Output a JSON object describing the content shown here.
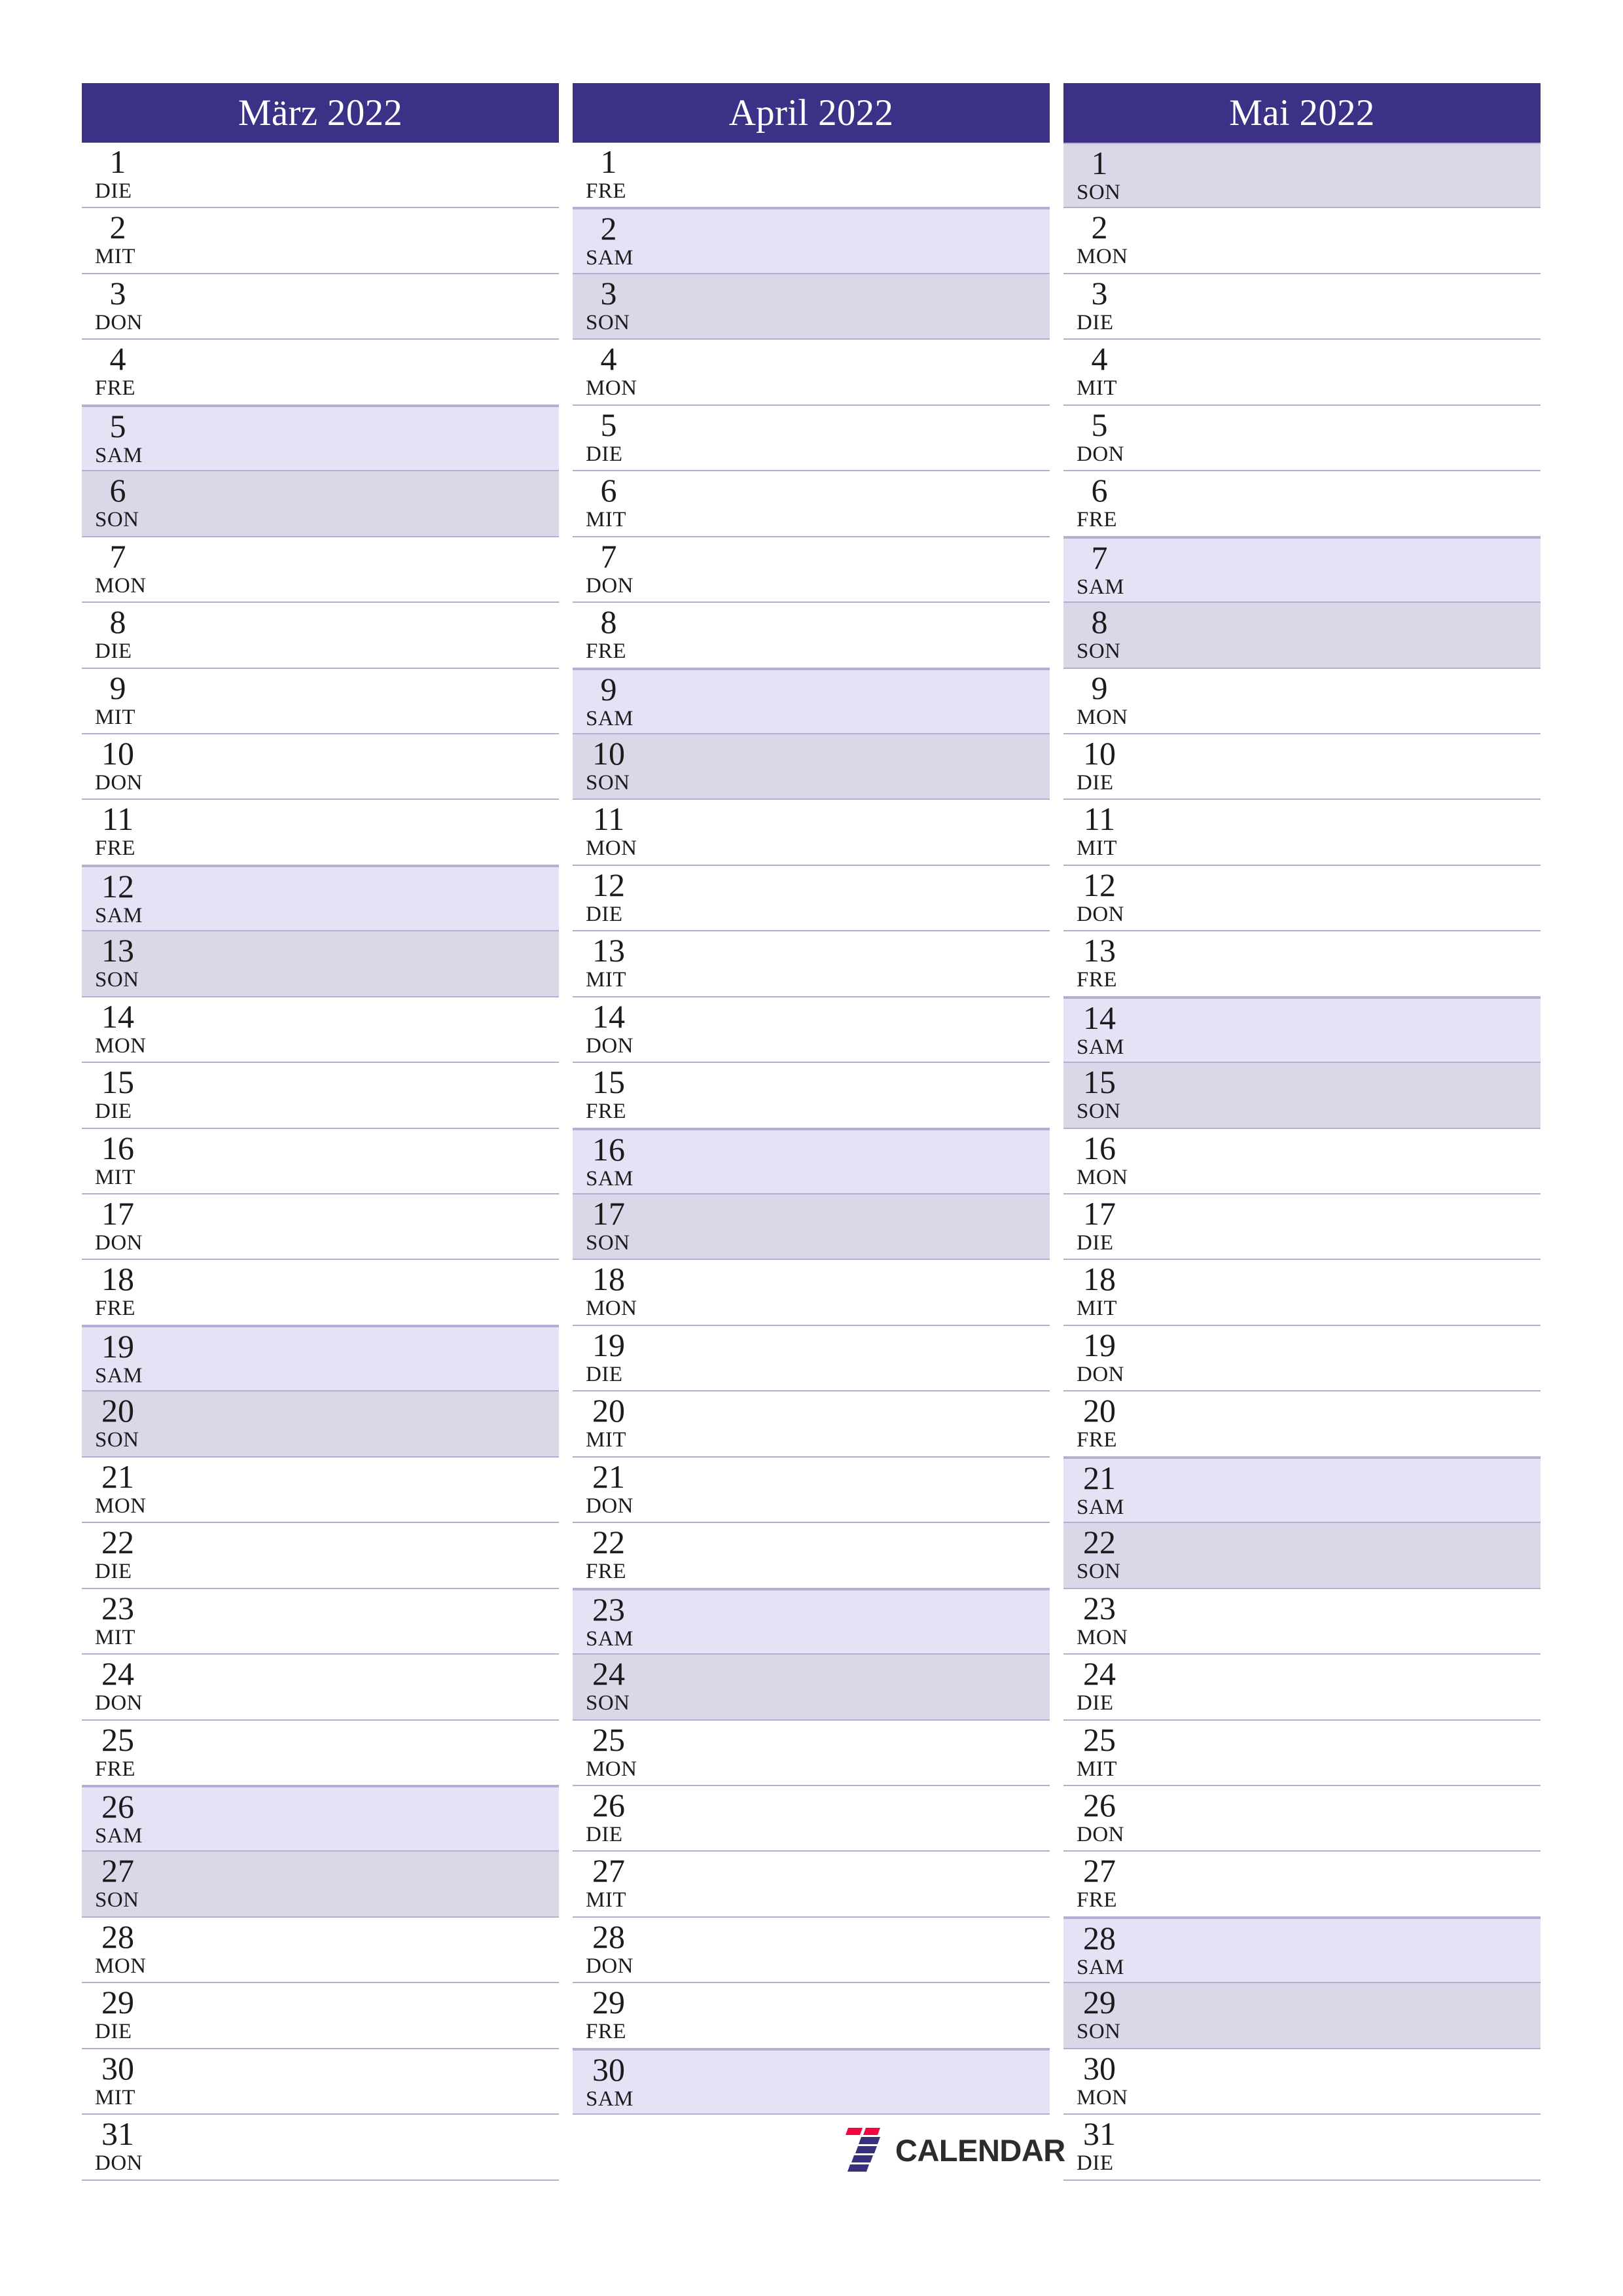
{
  "meta": {
    "locale": "de",
    "year": "2022",
    "accent_color": "#3b3186",
    "saturday_color": "#e4e2f5",
    "sunday_color": "#dbd7e9",
    "grid_line_color": "#b4afd2",
    "rows_per_column": 31
  },
  "logo": {
    "mark_name": "seven-calendar-logo-icon",
    "text": "CALENDAR",
    "mark_colors": [
      "#f4053f",
      "#36307e"
    ]
  },
  "months": [
    {
      "title": "März 2022",
      "name": "März",
      "days": [
        {
          "num": "1",
          "abbr": "DIE",
          "type": "weekday"
        },
        {
          "num": "2",
          "abbr": "MIT",
          "type": "weekday"
        },
        {
          "num": "3",
          "abbr": "DON",
          "type": "weekday"
        },
        {
          "num": "4",
          "abbr": "FRE",
          "type": "weekday"
        },
        {
          "num": "5",
          "abbr": "SAM",
          "type": "sat"
        },
        {
          "num": "6",
          "abbr": "SON",
          "type": "sun"
        },
        {
          "num": "7",
          "abbr": "MON",
          "type": "weekday"
        },
        {
          "num": "8",
          "abbr": "DIE",
          "type": "weekday"
        },
        {
          "num": "9",
          "abbr": "MIT",
          "type": "weekday"
        },
        {
          "num": "10",
          "abbr": "DON",
          "type": "weekday"
        },
        {
          "num": "11",
          "abbr": "FRE",
          "type": "weekday"
        },
        {
          "num": "12",
          "abbr": "SAM",
          "type": "sat"
        },
        {
          "num": "13",
          "abbr": "SON",
          "type": "sun"
        },
        {
          "num": "14",
          "abbr": "MON",
          "type": "weekday"
        },
        {
          "num": "15",
          "abbr": "DIE",
          "type": "weekday"
        },
        {
          "num": "16",
          "abbr": "MIT",
          "type": "weekday"
        },
        {
          "num": "17",
          "abbr": "DON",
          "type": "weekday"
        },
        {
          "num": "18",
          "abbr": "FRE",
          "type": "weekday"
        },
        {
          "num": "19",
          "abbr": "SAM",
          "type": "sat"
        },
        {
          "num": "20",
          "abbr": "SON",
          "type": "sun"
        },
        {
          "num": "21",
          "abbr": "MON",
          "type": "weekday"
        },
        {
          "num": "22",
          "abbr": "DIE",
          "type": "weekday"
        },
        {
          "num": "23",
          "abbr": "MIT",
          "type": "weekday"
        },
        {
          "num": "24",
          "abbr": "DON",
          "type": "weekday"
        },
        {
          "num": "25",
          "abbr": "FRE",
          "type": "weekday"
        },
        {
          "num": "26",
          "abbr": "SAM",
          "type": "sat"
        },
        {
          "num": "27",
          "abbr": "SON",
          "type": "sun"
        },
        {
          "num": "28",
          "abbr": "MON",
          "type": "weekday"
        },
        {
          "num": "29",
          "abbr": "DIE",
          "type": "weekday"
        },
        {
          "num": "30",
          "abbr": "MIT",
          "type": "weekday"
        },
        {
          "num": "31",
          "abbr": "DON",
          "type": "weekday"
        }
      ]
    },
    {
      "title": "April 2022",
      "name": "April",
      "days": [
        {
          "num": "1",
          "abbr": "FRE",
          "type": "weekday"
        },
        {
          "num": "2",
          "abbr": "SAM",
          "type": "sat"
        },
        {
          "num": "3",
          "abbr": "SON",
          "type": "sun"
        },
        {
          "num": "4",
          "abbr": "MON",
          "type": "weekday"
        },
        {
          "num": "5",
          "abbr": "DIE",
          "type": "weekday"
        },
        {
          "num": "6",
          "abbr": "MIT",
          "type": "weekday"
        },
        {
          "num": "7",
          "abbr": "DON",
          "type": "weekday"
        },
        {
          "num": "8",
          "abbr": "FRE",
          "type": "weekday"
        },
        {
          "num": "9",
          "abbr": "SAM",
          "type": "sat"
        },
        {
          "num": "10",
          "abbr": "SON",
          "type": "sun"
        },
        {
          "num": "11",
          "abbr": "MON",
          "type": "weekday"
        },
        {
          "num": "12",
          "abbr": "DIE",
          "type": "weekday"
        },
        {
          "num": "13",
          "abbr": "MIT",
          "type": "weekday"
        },
        {
          "num": "14",
          "abbr": "DON",
          "type": "weekday"
        },
        {
          "num": "15",
          "abbr": "FRE",
          "type": "weekday"
        },
        {
          "num": "16",
          "abbr": "SAM",
          "type": "sat"
        },
        {
          "num": "17",
          "abbr": "SON",
          "type": "sun"
        },
        {
          "num": "18",
          "abbr": "MON",
          "type": "weekday"
        },
        {
          "num": "19",
          "abbr": "DIE",
          "type": "weekday"
        },
        {
          "num": "20",
          "abbr": "MIT",
          "type": "weekday"
        },
        {
          "num": "21",
          "abbr": "DON",
          "type": "weekday"
        },
        {
          "num": "22",
          "abbr": "FRE",
          "type": "weekday"
        },
        {
          "num": "23",
          "abbr": "SAM",
          "type": "sat"
        },
        {
          "num": "24",
          "abbr": "SON",
          "type": "sun"
        },
        {
          "num": "25",
          "abbr": "MON",
          "type": "weekday"
        },
        {
          "num": "26",
          "abbr": "DIE",
          "type": "weekday"
        },
        {
          "num": "27",
          "abbr": "MIT",
          "type": "weekday"
        },
        {
          "num": "28",
          "abbr": "DON",
          "type": "weekday"
        },
        {
          "num": "29",
          "abbr": "FRE",
          "type": "weekday"
        },
        {
          "num": "30",
          "abbr": "SAM",
          "type": "sat"
        }
      ]
    },
    {
      "title": "Mai 2022",
      "name": "Mai",
      "days": [
        {
          "num": "1",
          "abbr": "SON",
          "type": "sun"
        },
        {
          "num": "2",
          "abbr": "MON",
          "type": "weekday"
        },
        {
          "num": "3",
          "abbr": "DIE",
          "type": "weekday"
        },
        {
          "num": "4",
          "abbr": "MIT",
          "type": "weekday"
        },
        {
          "num": "5",
          "abbr": "DON",
          "type": "weekday"
        },
        {
          "num": "6",
          "abbr": "FRE",
          "type": "weekday"
        },
        {
          "num": "7",
          "abbr": "SAM",
          "type": "sat"
        },
        {
          "num": "8",
          "abbr": "SON",
          "type": "sun"
        },
        {
          "num": "9",
          "abbr": "MON",
          "type": "weekday"
        },
        {
          "num": "10",
          "abbr": "DIE",
          "type": "weekday"
        },
        {
          "num": "11",
          "abbr": "MIT",
          "type": "weekday"
        },
        {
          "num": "12",
          "abbr": "DON",
          "type": "weekday"
        },
        {
          "num": "13",
          "abbr": "FRE",
          "type": "weekday"
        },
        {
          "num": "14",
          "abbr": "SAM",
          "type": "sat"
        },
        {
          "num": "15",
          "abbr": "SON",
          "type": "sun"
        },
        {
          "num": "16",
          "abbr": "MON",
          "type": "weekday"
        },
        {
          "num": "17",
          "abbr": "DIE",
          "type": "weekday"
        },
        {
          "num": "18",
          "abbr": "MIT",
          "type": "weekday"
        },
        {
          "num": "19",
          "abbr": "DON",
          "type": "weekday"
        },
        {
          "num": "20",
          "abbr": "FRE",
          "type": "weekday"
        },
        {
          "num": "21",
          "abbr": "SAM",
          "type": "sat"
        },
        {
          "num": "22",
          "abbr": "SON",
          "type": "sun"
        },
        {
          "num": "23",
          "abbr": "MON",
          "type": "weekday"
        },
        {
          "num": "24",
          "abbr": "DIE",
          "type": "weekday"
        },
        {
          "num": "25",
          "abbr": "MIT",
          "type": "weekday"
        },
        {
          "num": "26",
          "abbr": "DON",
          "type": "weekday"
        },
        {
          "num": "27",
          "abbr": "FRE",
          "type": "weekday"
        },
        {
          "num": "28",
          "abbr": "SAM",
          "type": "sat"
        },
        {
          "num": "29",
          "abbr": "SON",
          "type": "sun"
        },
        {
          "num": "30",
          "abbr": "MON",
          "type": "weekday"
        },
        {
          "num": "31",
          "abbr": "DIE",
          "type": "weekday"
        }
      ]
    }
  ]
}
